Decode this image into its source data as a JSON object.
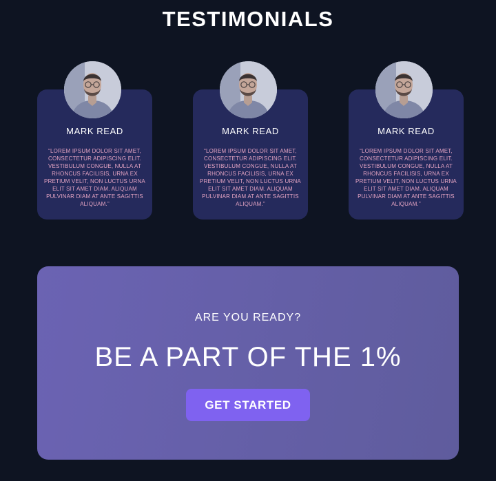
{
  "section": {
    "title": "TESTIMONIALS"
  },
  "testimonials": [
    {
      "name": "MARK READ",
      "quote": "“LOREM IPSUM DOLOR SIT AMET, CONSECTETUR ADIPISCING ELIT. VESTIBULUM CONGUE, NULLA AT RHONCUS FACILISIS, URNA EX PRETIUM VELIT, NON LUCTUS URNA ELIT SIT AMET DIAM. ALIQUAM PULVINAR DIAM AT ANTE SAGITTIS ALIQUAM.”"
    },
    {
      "name": "MARK READ",
      "quote": "“LOREM IPSUM DOLOR SIT AMET, CONSECTETUR ADIPISCING ELIT. VESTIBULUM CONGUE, NULLA AT RHONCUS FACILISIS, URNA EX PRETIUM VELIT, NON LUCTUS URNA ELIT SIT AMET DIAM. ALIQUAM PULVINAR DIAM AT ANTE SAGITTIS ALIQUAM.”"
    },
    {
      "name": "MARK READ",
      "quote": "“LOREM IPSUM DOLOR SIT AMET, CONSECTETUR ADIPISCING ELIT. VESTIBULUM CONGUE, NULLA AT RHONCUS FACILISIS, URNA EX PRETIUM VELIT, NON LUCTUS URNA ELIT SIT AMET DIAM. ALIQUAM PULVINAR DIAM AT ANTE SAGITTIS ALIQUAM.”"
    }
  ],
  "cta": {
    "subtitle": "ARE YOU READY?",
    "headline": "BE A PART OF THE 1%",
    "button_label": "GET STARTED"
  },
  "colors": {
    "background": "#0e1422",
    "card": "#252a5c",
    "quote_text": "#e3a3c2",
    "cta_panel": "#675fab",
    "button": "#7f62f0"
  },
  "icons": {
    "avatar": "person-photo"
  }
}
